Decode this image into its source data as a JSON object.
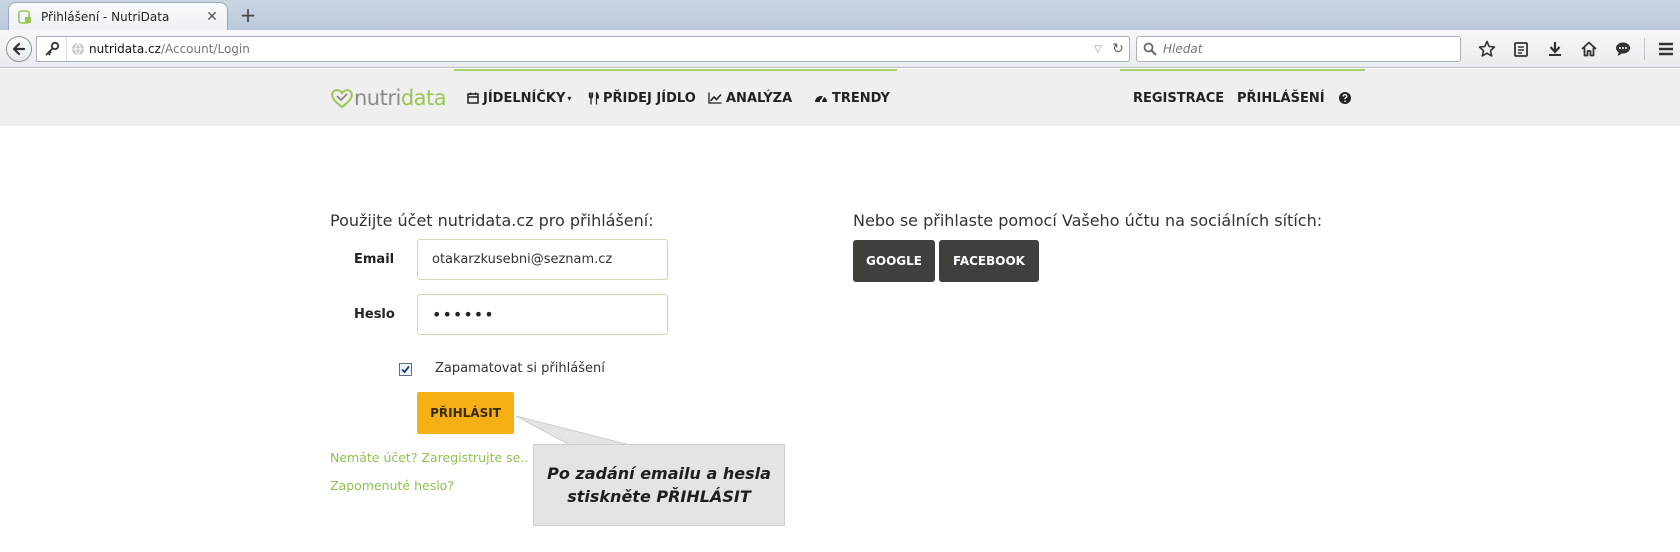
{
  "browser": {
    "tab_title": "Přihlášení - NutriData",
    "tab_close": "✕",
    "new_tab": "+",
    "url_host": "nutridata.cz",
    "url_path": "/Account/Login",
    "search_placeholder": "Hledat"
  },
  "site": {
    "logo_part1": "nutri",
    "logo_part2": "data",
    "nav": {
      "jidelnicky": "JÍDELNÍČKY",
      "pridej_jidlo": "PŘIDEJ JÍDLO",
      "analyza": "ANALÝZA",
      "trendy": "TRENDY",
      "registrace": "REGISTRACE",
      "prihlaseni": "PŘIHLÁŠENÍ"
    },
    "accent_color": "#9cc653"
  },
  "login": {
    "heading": "Použijte účet nutridata.cz pro přihlášení:",
    "email_label": "Email",
    "email_value": "otakarzkusebni@seznam.cz",
    "password_label": "Heslo",
    "password_value": "••••••",
    "remember_label": "Zapamatovat si přihlášení",
    "remember_checked": true,
    "submit_label": "PŘIHLÁSIT",
    "register_link": "Nemáte účet? Zaregistrujte se..",
    "forgot_link": "Zapomenuté heslo?",
    "button_color": "#f5b015"
  },
  "social": {
    "heading": "Nebo se přihlaste pomocí Vašeho účtu na sociálních sítích:",
    "google_label": "GOOGLE",
    "facebook_label": "FACEBOOK"
  },
  "callout": {
    "line1": "Po zadání emailu a hesla",
    "line2": "stiskněte PŘIHLÁSIT"
  }
}
